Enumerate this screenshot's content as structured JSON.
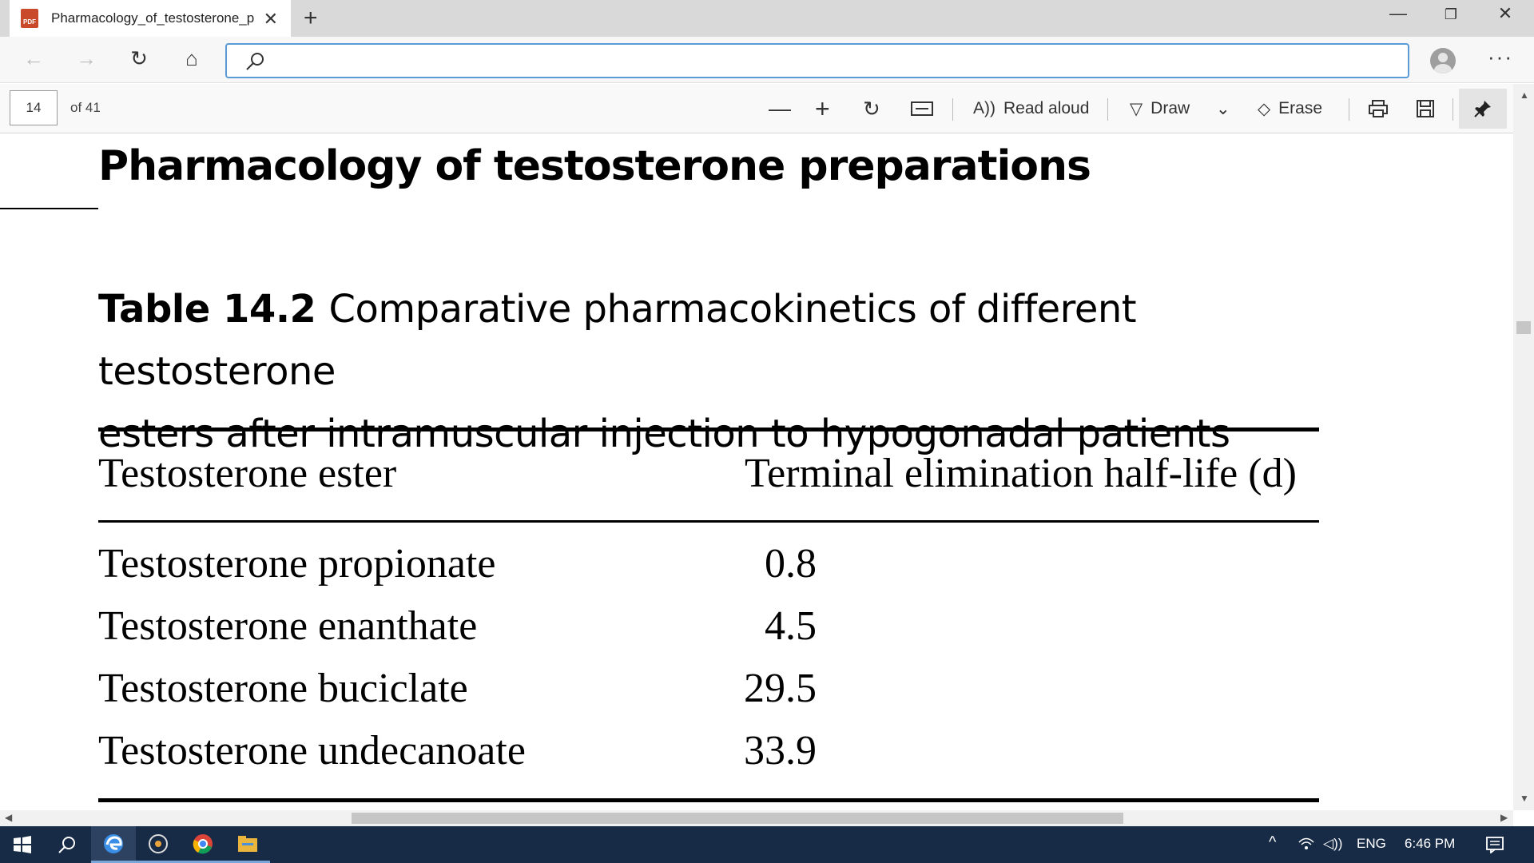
{
  "browser": {
    "tab_title": "Pharmacology_of_testosterone_p",
    "address_value": "",
    "icons": [
      "back-icon",
      "forward-icon",
      "refresh-icon",
      "home-icon",
      "search-icon",
      "profile-icon",
      "more-icon"
    ]
  },
  "pdf_toolbar": {
    "page_number": "14",
    "page_count": "of 41",
    "read_aloud_label": "Read aloud",
    "draw_label": "Draw",
    "erase_label": "Erase"
  },
  "document": {
    "heading": "Pharmacology of testosterone preparations",
    "table_label": "Table 14.2",
    "table_caption_line1": "Comparative pharmacokinetics of different testosterone",
    "table_caption_line2": "esters after intramuscular injection to hypogonadal patients",
    "columns": [
      "Testosterone ester",
      "Terminal elimination half-life (d)"
    ],
    "rows": [
      {
        "ester": "Testosterone propionate",
        "half_life": "0.8"
      },
      {
        "ester": "Testosterone enanthate",
        "half_life": "4.5"
      },
      {
        "ester": "Testosterone buciclate",
        "half_life": "29.5"
      },
      {
        "ester": "Testosterone undecanoate",
        "half_life": "33.9"
      }
    ]
  },
  "taskbar": {
    "language": "ENG",
    "time": "6:46 PM"
  },
  "colors": {
    "taskbar_bg": "#172b47",
    "address_focus": "#5b9bd5",
    "pdf_icon": "#c84a2a"
  }
}
